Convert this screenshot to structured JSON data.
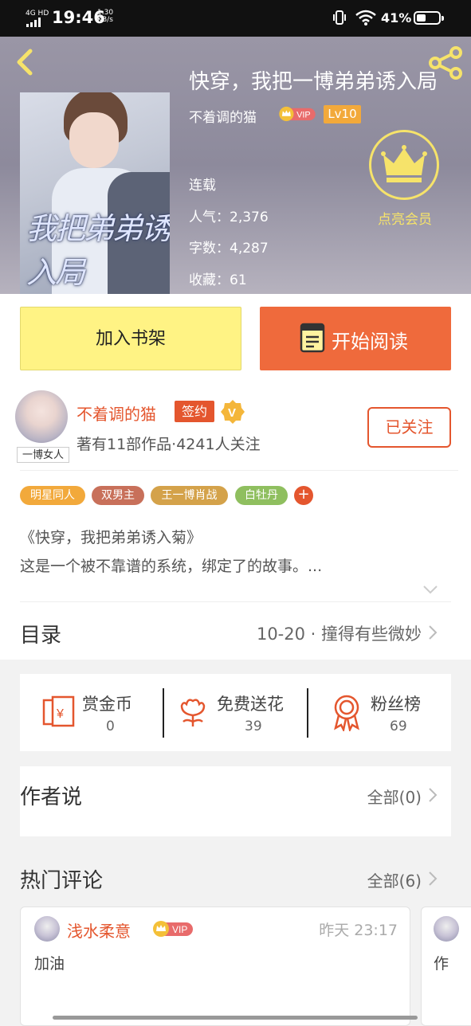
{
  "status_bar": {
    "network": "4G HD",
    "time": "19:46",
    "speed_value": "1.30",
    "speed_unit": "KB/s",
    "battery": "41%"
  },
  "book": {
    "title": "快穿，我把一博弟弟诱入局",
    "author": "不着调的猫",
    "author_vip": "VIP",
    "author_level": "Lv10",
    "status": "连载",
    "popularity": "人气：2,376",
    "word_count": "字数：4,287",
    "favorites": "收藏：61",
    "cover_title": "我把弟弟诱入局"
  },
  "member": {
    "label": "点亮会员"
  },
  "actions": {
    "add_shelf": "加入书架",
    "start_reading": "开始阅读"
  },
  "author_card": {
    "avatar_tag": "一博女人",
    "name": "不着调的猫",
    "sign": "签约",
    "verified": "V",
    "stats": "著有11部作品·4241人关注",
    "follow": "已关注"
  },
  "tags": [
    {
      "label": "明星同人",
      "color": "#f2a93b"
    },
    {
      "label": "双男主",
      "color": "#c8705a"
    },
    {
      "label": "王一博肖战",
      "color": "#d4a24a"
    },
    {
      "label": "白牡丹",
      "color": "#8fbf5f"
    }
  ],
  "tag_more": "+",
  "intro": {
    "line1": "《快穿，我把弟弟诱入菊》",
    "line2": "这是一个被不靠谱的系统，绑定了的故事。..."
  },
  "toc": {
    "label": "目录",
    "latest": "10-20 · 撞得有些微妙"
  },
  "stats": [
    {
      "label": "赏金币",
      "value": "0",
      "icon": "reward-coin-icon"
    },
    {
      "label": "免费送花",
      "value": "39",
      "icon": "flower-icon"
    },
    {
      "label": "粉丝榜",
      "value": "69",
      "icon": "medal-icon"
    }
  ],
  "author_says": {
    "label": "作者说",
    "link": "全部(0)"
  },
  "comments": {
    "label": "热门评论",
    "link": "全部(6)",
    "items": [
      {
        "user": "浅水柔意",
        "vip": "VIP",
        "time": "昨天 23:17",
        "text": "加油"
      },
      {
        "text": "作"
      }
    ]
  },
  "colors": {
    "accent": "#e4562e",
    "read_button": "#ef6a3c",
    "shelf_button": "#fff384",
    "gold": "#f6e36a"
  }
}
